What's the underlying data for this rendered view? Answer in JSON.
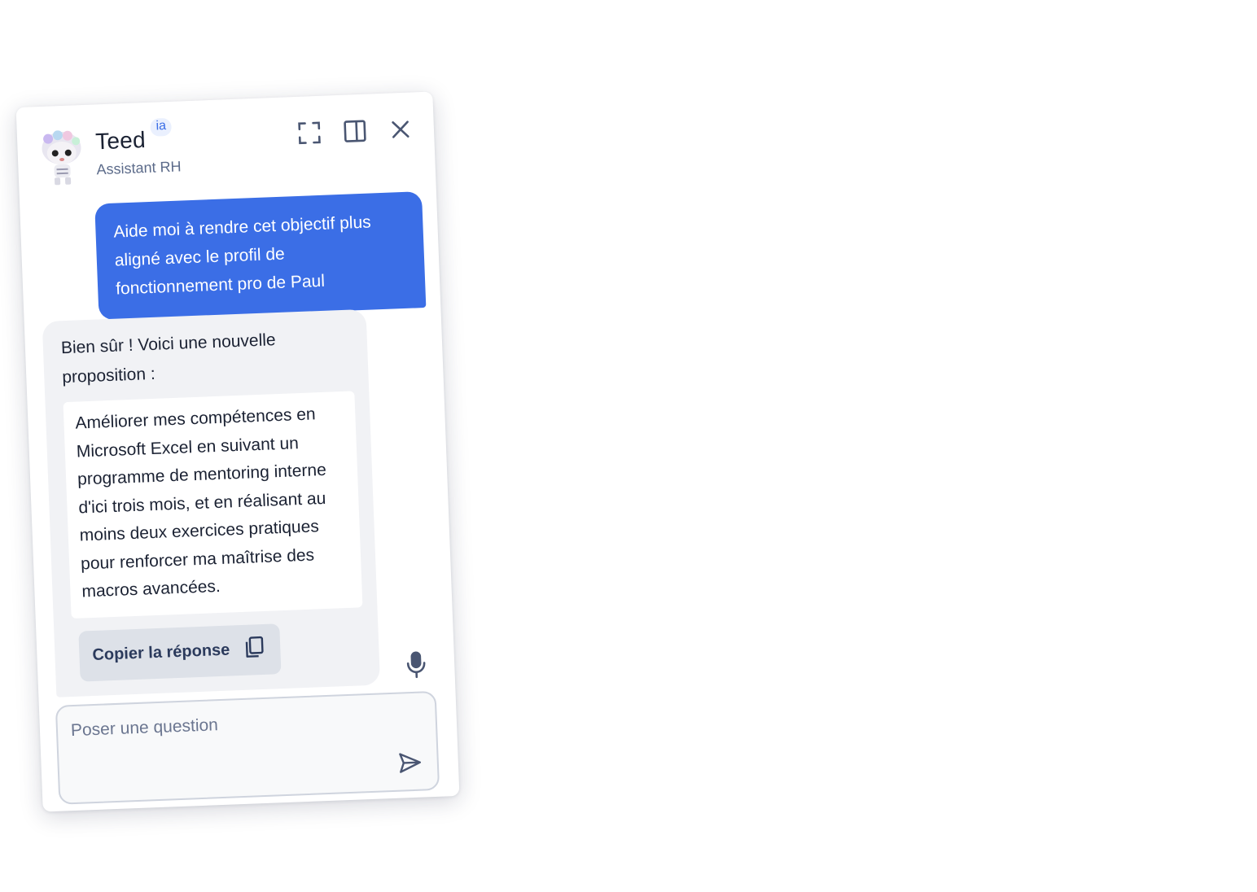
{
  "header": {
    "title": "Teed",
    "badge": "ia",
    "subtitle": "Assistant RH",
    "icons": [
      "expand-icon",
      "side-panel-icon",
      "close-icon"
    ]
  },
  "messages": {
    "user": "Aide moi à rendre cet objectif plus aligné avec le profil de fonctionnement pro de Paul",
    "bot_intro": "Bien sûr ! Voici une nouvelle proposition :",
    "bot_proposal": "Améliorer mes compétences en Microsoft Excel en suivant un programme de mentoring interne d'ici trois mois, et en réalisant au moins deux exercices pratiques pour renforcer ma maîtrise des macros avancées.",
    "copy_label": "Copier la réponse",
    "copy_icon": "copy-icon"
  },
  "composer": {
    "placeholder": "Poser une question",
    "value": "",
    "mic_icon": "microphone-icon",
    "send_icon": "send-icon"
  },
  "colors": {
    "accent": "#3b6ee6",
    "bubble_bot": "#f1f2f5",
    "text": "#1b2233",
    "muted": "#5c6b8a"
  }
}
